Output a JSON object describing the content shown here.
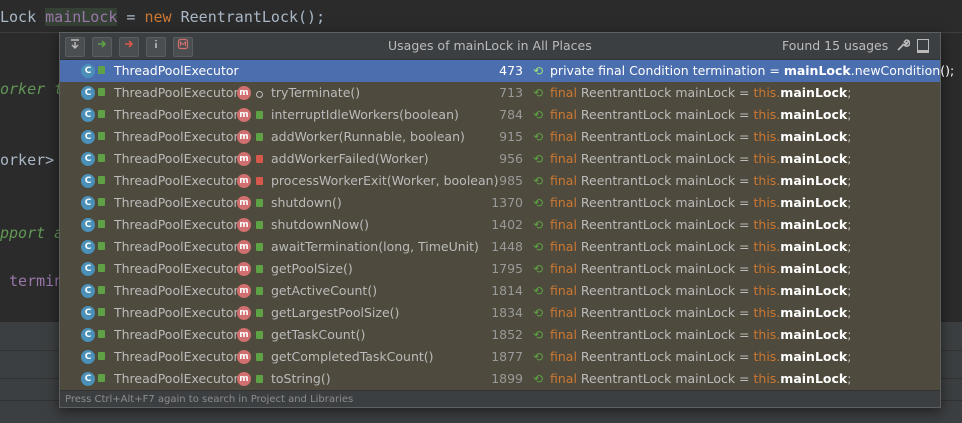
{
  "editor": {
    "line1": {
      "a": "Lock ",
      "b": "mainLock",
      "c": " = ",
      "d": "new",
      "e": " ReentrantLock();"
    },
    "frag_worker": "orker t",
    "frag_worker2": "orker>",
    "frag_support": "pport a",
    "frag_termin": " termin"
  },
  "popup": {
    "title": "Usages of mainLock in All Places",
    "found": "Found 15 usages",
    "footer": "Press Ctrl+Alt+F7 again to search in Project and Libraries",
    "toolbar": {
      "expand_icon": "expand-all-icon",
      "next_icon": "navigate-next-icon",
      "prev_icon": "navigate-prev-icon",
      "info_icon": "info-icon",
      "merge_icon": "merge-usages-icon",
      "settings_icon": "wrench-icon",
      "pin_icon": "pin-window-icon"
    },
    "rows": [
      {
        "cls": "ThreadPoolExecutor",
        "method": "",
        "line": "473",
        "code_pre": "private final Condition termination = ",
        "code_bold": "mainLock",
        "code_post": ".newCondition();"
      },
      {
        "cls": "ThreadPoolExecutor",
        "method": "tryTerminate()",
        "line": "713",
        "code_pre": "final",
        "code_mid": " ReentrantLock mainLock = ",
        "code_this": "this.",
        "code_bold": "mainLock",
        "code_post": ";"
      },
      {
        "cls": "ThreadPoolExecutor",
        "method": "interruptIdleWorkers(boolean)",
        "line": "784",
        "code_pre": "final",
        "code_mid": " ReentrantLock mainLock = ",
        "code_this": "this.",
        "code_bold": "mainLock",
        "code_post": ";"
      },
      {
        "cls": "ThreadPoolExecutor",
        "method": "addWorker(Runnable, boolean)",
        "line": "915",
        "code_pre": "final",
        "code_mid": " ReentrantLock mainLock = ",
        "code_this": "this.",
        "code_bold": "mainLock",
        "code_post": ";"
      },
      {
        "cls": "ThreadPoolExecutor",
        "method": "addWorkerFailed(Worker)",
        "line": "956",
        "code_pre": "final",
        "code_mid": " ReentrantLock mainLock = ",
        "code_this": "this.",
        "code_bold": "mainLock",
        "code_post": ";"
      },
      {
        "cls": "ThreadPoolExecutor",
        "method": "processWorkerExit(Worker, boolean)",
        "line": "985",
        "code_pre": "final",
        "code_mid": " ReentrantLock mainLock = ",
        "code_this": "this.",
        "code_bold": "mainLock",
        "code_post": ";"
      },
      {
        "cls": "ThreadPoolExecutor",
        "method": "shutdown()",
        "line": "1370",
        "code_pre": "final",
        "code_mid": " ReentrantLock mainLock = ",
        "code_this": "this.",
        "code_bold": "mainLock",
        "code_post": ";"
      },
      {
        "cls": "ThreadPoolExecutor",
        "method": "shutdownNow()",
        "line": "1402",
        "code_pre": "final",
        "code_mid": " ReentrantLock mainLock = ",
        "code_this": "this.",
        "code_bold": "mainLock",
        "code_post": ";"
      },
      {
        "cls": "ThreadPoolExecutor",
        "method": "awaitTermination(long, TimeUnit)",
        "line": "1448",
        "code_pre": "final",
        "code_mid": " ReentrantLock mainLock = ",
        "code_this": "this.",
        "code_bold": "mainLock",
        "code_post": ";"
      },
      {
        "cls": "ThreadPoolExecutor",
        "method": "getPoolSize()",
        "line": "1795",
        "code_pre": "final",
        "code_mid": " ReentrantLock mainLock = ",
        "code_this": "this.",
        "code_bold": "mainLock",
        "code_post": ";"
      },
      {
        "cls": "ThreadPoolExecutor",
        "method": "getActiveCount()",
        "line": "1814",
        "code_pre": "final",
        "code_mid": " ReentrantLock mainLock = ",
        "code_this": "this.",
        "code_bold": "mainLock",
        "code_post": ";"
      },
      {
        "cls": "ThreadPoolExecutor",
        "method": "getLargestPoolSize()",
        "line": "1834",
        "code_pre": "final",
        "code_mid": " ReentrantLock mainLock = ",
        "code_this": "this.",
        "code_bold": "mainLock",
        "code_post": ";"
      },
      {
        "cls": "ThreadPoolExecutor",
        "method": "getTaskCount()",
        "line": "1852",
        "code_pre": "final",
        "code_mid": " ReentrantLock mainLock = ",
        "code_this": "this.",
        "code_bold": "mainLock",
        "code_post": ";"
      },
      {
        "cls": "ThreadPoolExecutor",
        "method": "getCompletedTaskCount()",
        "line": "1877",
        "code_pre": "final",
        "code_mid": " ReentrantLock mainLock = ",
        "code_this": "this.",
        "code_bold": "mainLock",
        "code_post": ";"
      },
      {
        "cls": "ThreadPoolExecutor",
        "method": "toString()",
        "line": "1899",
        "code_pre": "final",
        "code_mid": " ReentrantLock mainLock = ",
        "code_this": "this.",
        "code_bold": "mainLock",
        "code_post": ";"
      }
    ]
  }
}
